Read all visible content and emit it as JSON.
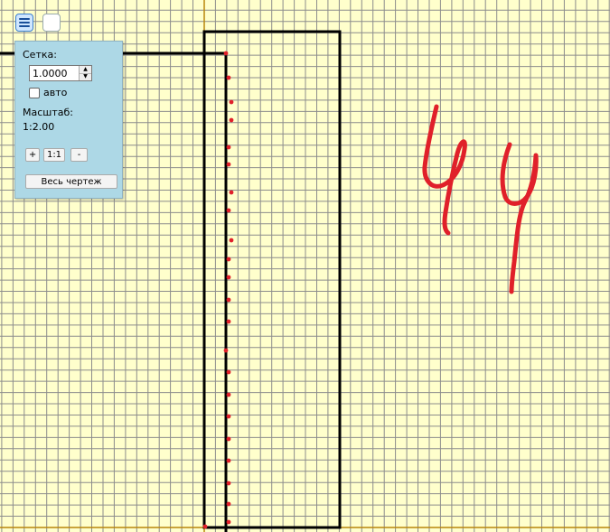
{
  "toolbar": {
    "menu_icon": "hamburger-menu-icon",
    "blank_icon": "blank-button"
  },
  "panel": {
    "grid_label": "Сетка:",
    "grid_value": "1.0000",
    "auto_label": "авто",
    "auto_checked": false,
    "scale_label": "Масштаб:",
    "scale_value": "1:2.00",
    "zoom_in": "+",
    "zoom_reset": "1:1",
    "zoom_out": "-",
    "fit_all": "Весь чертеж"
  },
  "colors": {
    "background": "#ffffcc",
    "grid": "#8c8c8c",
    "axis": "#b8860b",
    "panel": "#add8e6",
    "drawing": "#000000",
    "points": "#e0202a",
    "ink": "#e0202a"
  },
  "drawing": {
    "handwritten_text": "чч"
  }
}
